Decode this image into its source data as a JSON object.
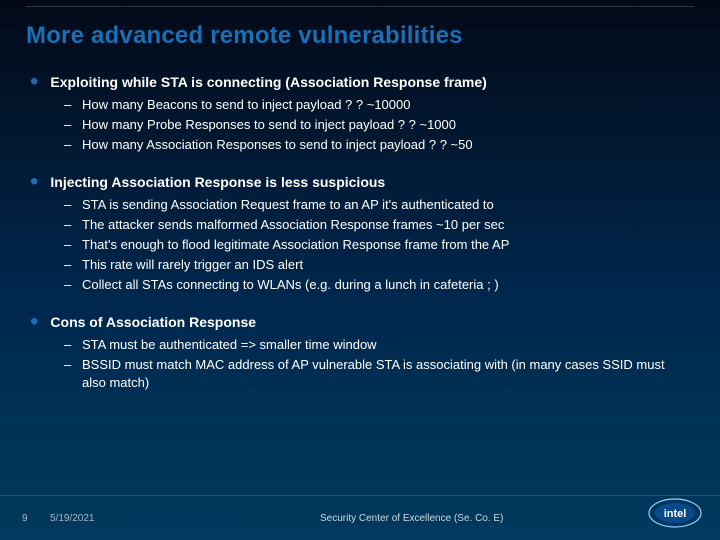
{
  "title": "More advanced remote vulnerabilities",
  "bullets": [
    {
      "head": "Exploiting while STA is connecting (Association Response frame)",
      "subs": [
        "How many Beacons to send to inject payload ? ? ~10000",
        "How many Probe Responses to send to inject payload ? ? ~1000",
        "How many Association Responses to send to inject payload ? ? ~50"
      ]
    },
    {
      "head": "Injecting Association Response is less suspicious",
      "subs": [
        "STA is sending Association Request frame to an AP it's authenticated to",
        "The attacker sends malformed Association Response frames ~10 per sec",
        "That's enough to flood legitimate Association Response frame from the AP",
        "This rate will rarely trigger an IDS alert",
        "Collect all STAs connecting to WLANs (e.g. during a lunch in cafeteria ; )"
      ]
    },
    {
      "head": "Cons of Association Response",
      "subs": [
        "STA must be authenticated => smaller time window",
        "BSSID must match MAC address of AP vulnerable STA is associating with (in many cases SSID must also match)"
      ]
    }
  ],
  "footer": {
    "page": "9",
    "date": "5/19/2021",
    "center": "Security Center of Excellence (Se. Co. E)"
  },
  "logo_name": "intel-logo"
}
